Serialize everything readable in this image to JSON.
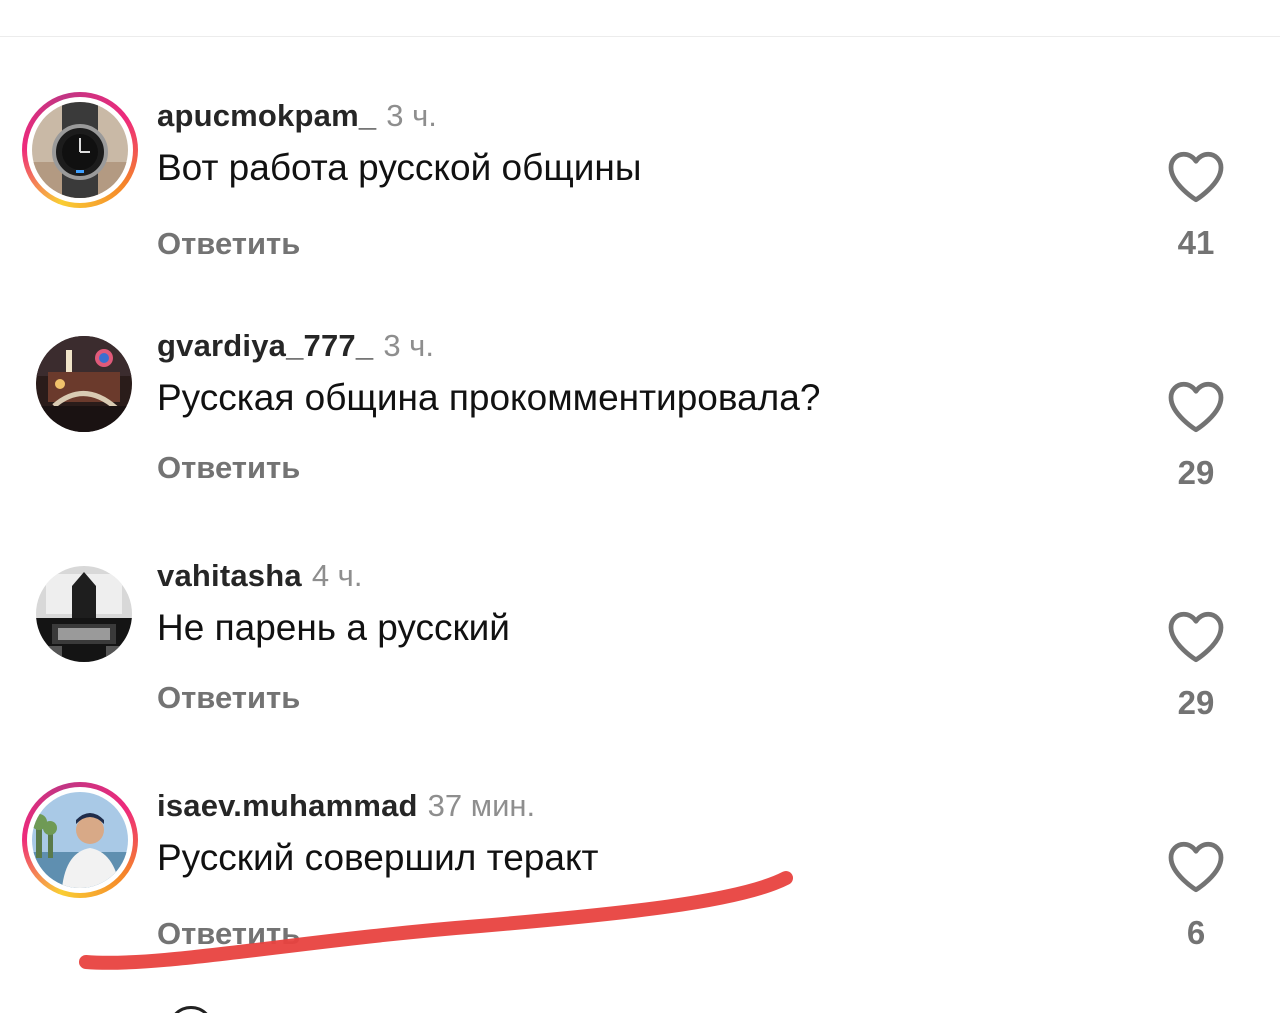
{
  "comments": [
    {
      "username": "apucmokpam_",
      "time": "3 ч.",
      "text": "Вот работа русской общины",
      "reply_label": "Ответить",
      "likes": "41",
      "story_ring": true
    },
    {
      "username": "gvardiya_777_",
      "time": "3 ч.",
      "text": "Русская община прокомментировала?",
      "reply_label": "Ответить",
      "likes": "29",
      "story_ring": false
    },
    {
      "username": "vahitasha",
      "time": "4 ч.",
      "text": "Не парень а русский",
      "reply_label": "Ответить",
      "likes": "29",
      "story_ring": false
    },
    {
      "username": "isaev.muhammad",
      "time": "37 мин.",
      "text": "Русский совершил теракт",
      "reply_label": "Ответить",
      "likes": "6",
      "story_ring": true
    }
  ],
  "icons": {
    "like": "heart-icon"
  },
  "colors": {
    "secondary_text": "#737373",
    "time_text": "#8e8e8e",
    "annotation": "#e8423f"
  }
}
